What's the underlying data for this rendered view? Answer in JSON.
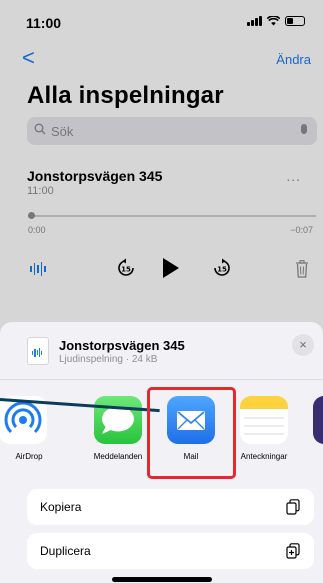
{
  "status_bar": {
    "time": "11:00"
  },
  "nav": {
    "back": "<",
    "edit": "Ändra"
  },
  "page": {
    "title": "Alla inspelningar"
  },
  "search": {
    "placeholder": "Sök"
  },
  "recording": {
    "title": "Jonstorpsvägen 345",
    "time": "11:00",
    "more": "...",
    "elapsed": "0:00",
    "remaining": "−0:07"
  },
  "share_sheet": {
    "file_title": "Jonstorpsvägen 345",
    "file_subtitle": "Ljudinspelning · 24 kB",
    "close": "×",
    "apps": [
      {
        "label": "AirDrop",
        "icon": "airdrop-icon"
      },
      {
        "label": "Meddelanden",
        "icon": "messages-icon"
      },
      {
        "label": "Mail",
        "icon": "mail-icon"
      },
      {
        "label": "Anteckningar",
        "icon": "notes-icon"
      },
      {
        "label": "",
        "icon": "app-icon"
      }
    ],
    "actions": [
      {
        "label": "Kopiera",
        "icon": "copy-icon"
      },
      {
        "label": "Duplicera",
        "icon": "duplicate-icon"
      }
    ]
  },
  "colors": {
    "accent": "#1b7cf5",
    "highlight": "#e8262f",
    "pointer": "#0b3c59"
  }
}
